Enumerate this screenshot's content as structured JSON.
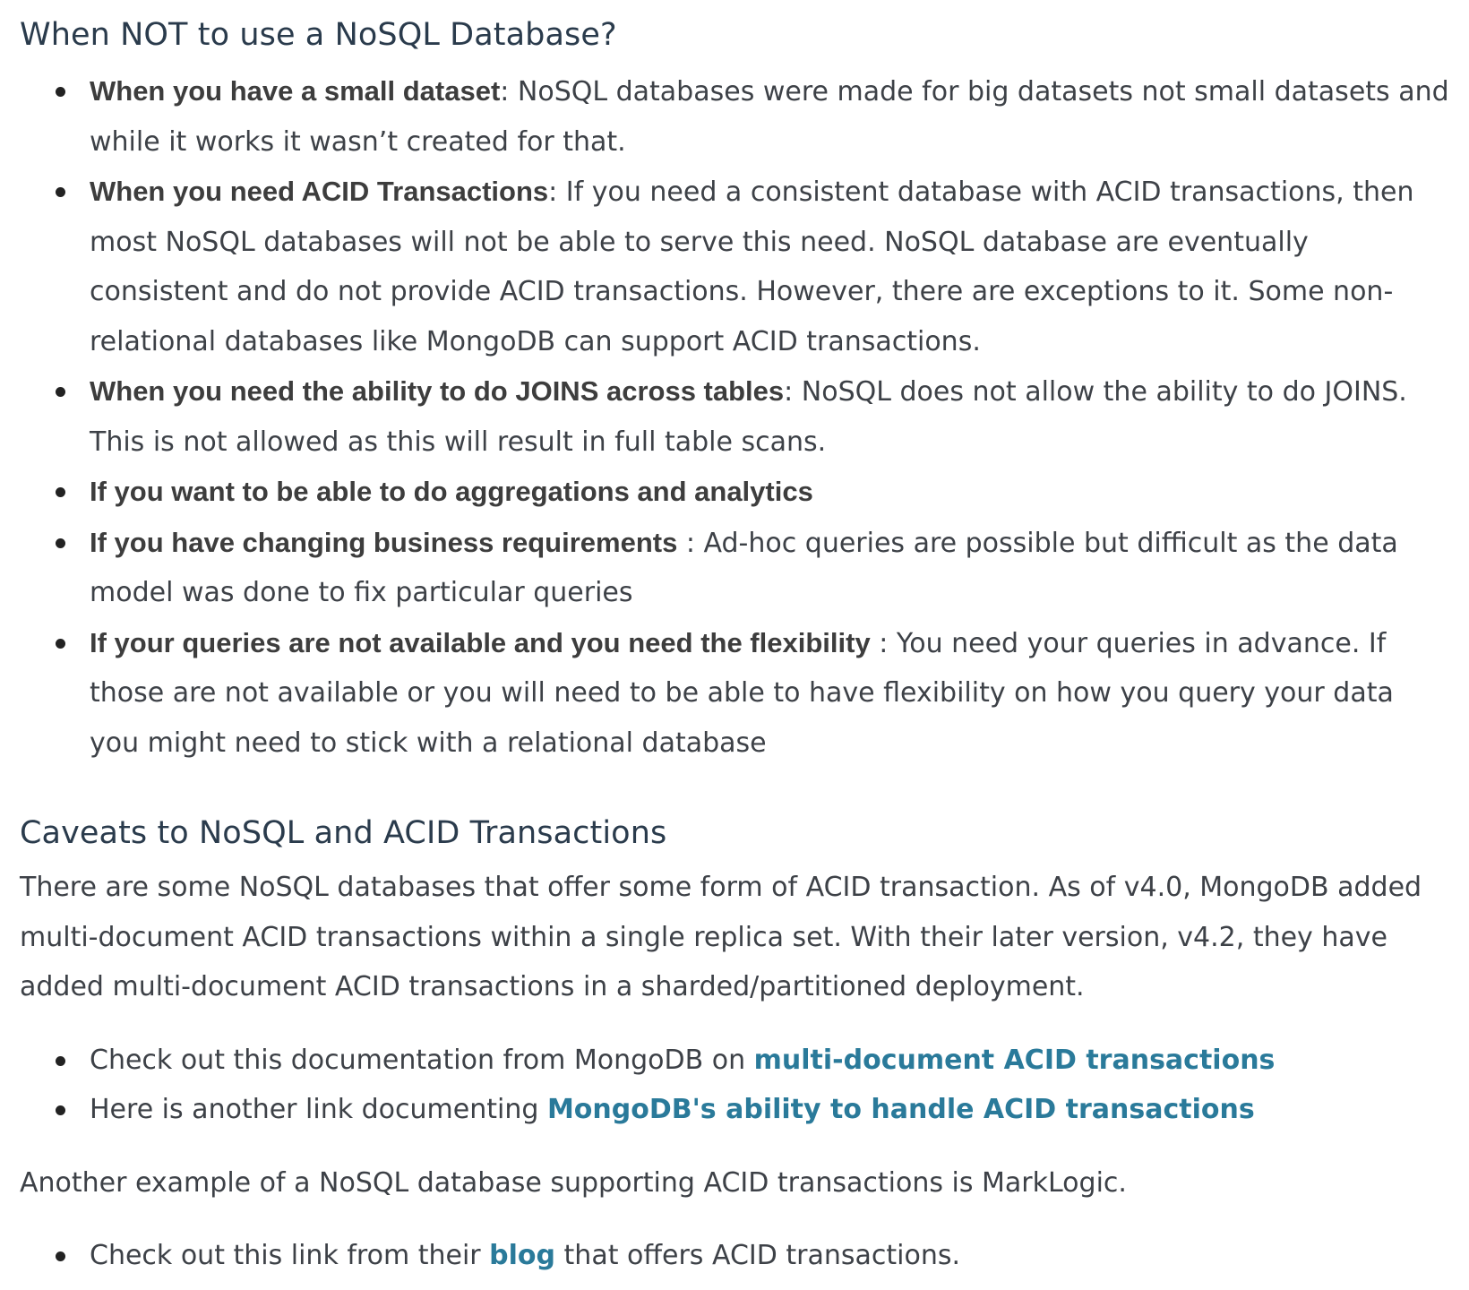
{
  "section1": {
    "heading": "When NOT to use a NoSQL Database?",
    "items": [
      {
        "lead": "When you have a small dataset",
        "text": ": NoSQL databases were made for big datasets not small datasets and while it works it wasn’t created for that."
      },
      {
        "lead": "When you need ACID Transactions",
        "text": ": If you need a consistent database with ACID transactions, then most NoSQL databases will not be able to serve this need. NoSQL database are eventually consistent and do not provide ACID transactions. However, there are exceptions to it. Some non-relational databases like MongoDB can support ACID transactions."
      },
      {
        "lead": "When you need the ability to do JOINS across tables",
        "text": ": NoSQL does not allow the ability to do JOINS. This is not allowed as this will result in full table scans."
      },
      {
        "lead": "If you want to be able to do aggregations and analytics",
        "text": ""
      },
      {
        "lead": "If you have changing business requirements",
        "text": " : Ad-hoc queries are possible but difficult as the data model was done to fix particular queries"
      },
      {
        "lead": "If your queries are not available and you need the flexibility",
        "text": " : You need your queries in advance. If those are not available or you will need to be able to have flexibility on how you query your data you might need to stick with a relational database"
      }
    ]
  },
  "section2": {
    "heading": "Caveats to NoSQL and ACID Transactions",
    "paragraph": "There are some NoSQL databases that offer some form of ACID transaction. As of v4.0, MongoDB added multi-document ACID transactions within a single replica set. With their later version, v4.2, they have added multi-document ACID transactions in a sharded/partitioned deployment.",
    "links": [
      {
        "before": "Check out this documentation from MongoDB on ",
        "link": "multi-document ACID transactions"
      },
      {
        "before": "Here is another link documenting ",
        "link": "MongoDB's ability to handle ACID transactions"
      }
    ],
    "paragraph2": "Another example of a NoSQL database supporting ACID transactions is MarkLogic.",
    "links2": [
      {
        "before": "Check out this link from their ",
        "link": "blog",
        "after": " that offers ACID transactions."
      }
    ]
  }
}
